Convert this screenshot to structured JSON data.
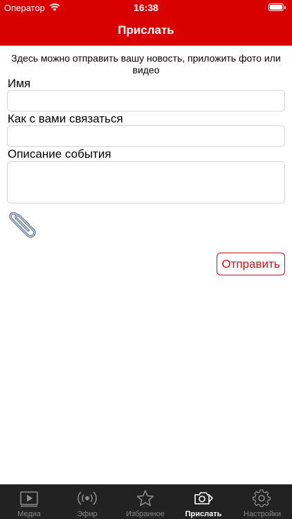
{
  "status_bar": {
    "carrier": "Оператор",
    "time": "16:38"
  },
  "nav": {
    "title": "Прислать"
  },
  "form": {
    "intro": "Здесь можно отправить вашу новость, приложить фото или видео",
    "name_label": "Имя",
    "name_value": "",
    "contact_label": "Как с вами связаться",
    "contact_value": "",
    "description_label": "Описание события",
    "description_value": "",
    "send_label": "Отправить"
  },
  "tabs": [
    {
      "label": "Медиа",
      "icon": "media-icon"
    },
    {
      "label": "Эфир",
      "icon": "broadcast-icon"
    },
    {
      "label": "Избранное",
      "icon": "star-icon"
    },
    {
      "label": "Прислать",
      "icon": "camera-send-icon",
      "active": true
    },
    {
      "label": "Настройки",
      "icon": "gear-icon"
    }
  ],
  "colors": {
    "accent": "#d90000",
    "button": "#c4161c",
    "tabbar": "#222222"
  }
}
